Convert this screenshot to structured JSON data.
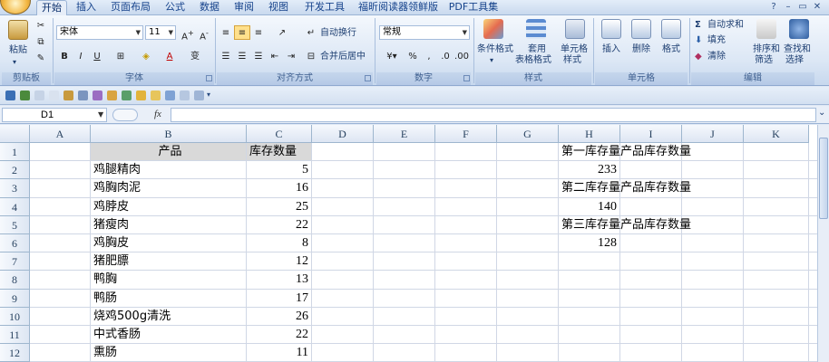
{
  "tabs": [
    {
      "label": "开始",
      "active": true
    },
    {
      "label": "插入"
    },
    {
      "label": "页面布局"
    },
    {
      "label": "公式"
    },
    {
      "label": "数据"
    },
    {
      "label": "审阅"
    },
    {
      "label": "视图"
    },
    {
      "label": "开发工具"
    },
    {
      "label": "福昕阅读器领鲜版"
    },
    {
      "label": "PDF工具集"
    }
  ],
  "ribbon": {
    "clipboard": {
      "paste": "粘贴",
      "label": "剪贴板"
    },
    "font": {
      "name": "宋体",
      "size": "11",
      "bold": "B",
      "italic": "I",
      "underline": "U",
      "label": "字体"
    },
    "alignment": {
      "wrap": "自动换行",
      "merge": "合并后居中",
      "label": "对齐方式"
    },
    "number": {
      "format": "常规",
      "percent": "%",
      "comma": ",",
      "label": "数字"
    },
    "styles": {
      "conditional": "条件格式",
      "table": "套用",
      "table2": "表格格式",
      "cell": "单元格",
      "cell2": "样式",
      "label": "样式"
    },
    "cells": {
      "insert": "插入",
      "delete": "删除",
      "format": "格式",
      "label": "单元格"
    },
    "editing": {
      "autosum": "自动求和",
      "fill": "填充",
      "clear": "清除",
      "sort": "排序和",
      "sort2": "筛选",
      "find": "查找和",
      "find2": "选择",
      "label": "编辑"
    }
  },
  "formula_bar": {
    "name_box": "D1",
    "fx": "fx",
    "formula": ""
  },
  "columns": [
    "A",
    "B",
    "C",
    "D",
    "E",
    "F",
    "G",
    "H",
    "I",
    "J",
    "K"
  ],
  "rows": [
    "1",
    "2",
    "3",
    "4",
    "5",
    "6",
    "7",
    "8",
    "9",
    "10",
    "11",
    "12"
  ],
  "cells": {
    "B1": "产品",
    "C1": "库存数量",
    "B2": "鸡腿精肉",
    "C2": "5",
    "B3": "鸡胸肉泥",
    "C3": "16",
    "B4": "鸡脖皮",
    "C4": "25",
    "B5": "猪瘦肉",
    "C5": "22",
    "B6": "鸡胸皮",
    "C6": "8",
    "B7": "猪肥膘",
    "C7": "12",
    "B8": "鸭胸",
    "C8": "13",
    "B9": "鸭肠",
    "C9": "17",
    "B10": "烧鸡500g清洗",
    "C10": "26",
    "B11": "中式香肠",
    "C11": "22",
    "B12": "熏肠",
    "C12": "11",
    "H1": "第一库存量产品库存数量",
    "H2": "233",
    "H3": "第二库存量产品库存数量",
    "H4": "140",
    "H5": "第三库存量产品库存数量",
    "H6": "128"
  }
}
